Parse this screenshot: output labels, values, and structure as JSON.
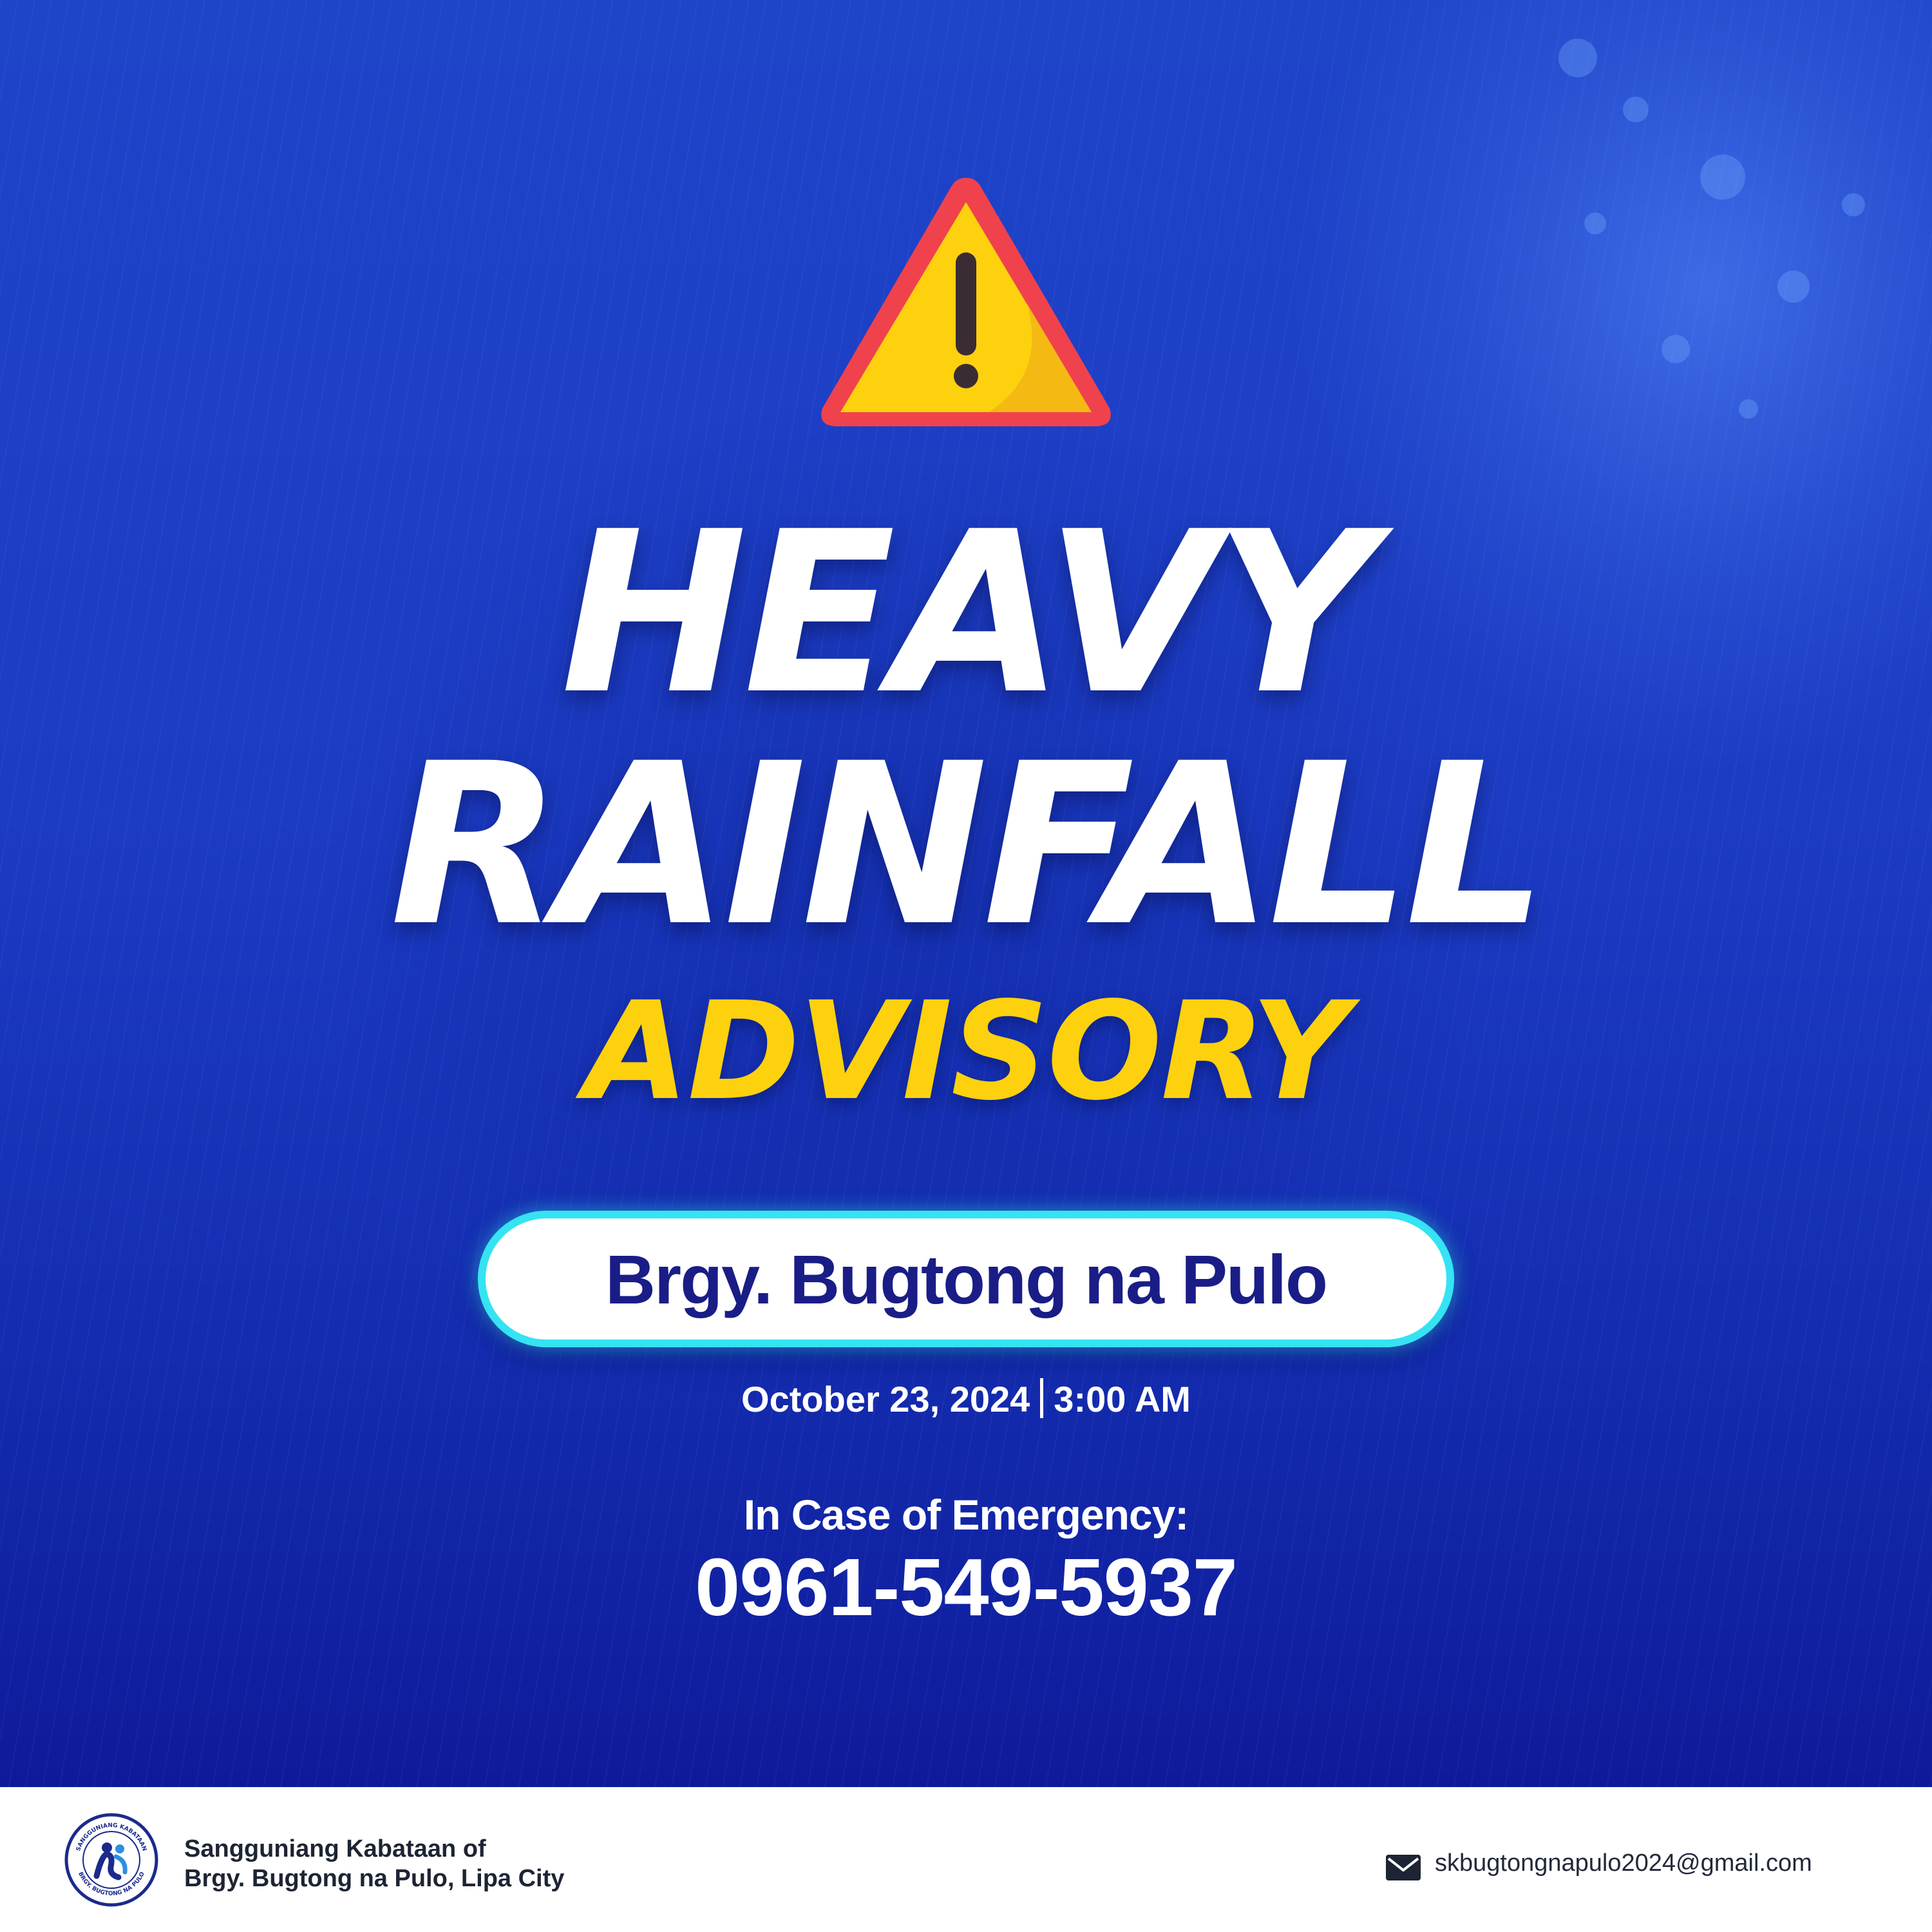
{
  "advisory": {
    "title_line1": "HEAVY",
    "title_line2": "RAINFALL",
    "title_line3": "ADVISORY",
    "location": "Brgy. Bugtong na Pulo",
    "date": "October 23, 2024",
    "time": "3:00 AM"
  },
  "emergency": {
    "label": "In Case of Emergency:",
    "number": "0961-549-5937"
  },
  "footer": {
    "org_line1": "Sangguniang Kabataan of",
    "org_line2": "Brgy. Bugtong na Pulo, Lipa City",
    "email": "skbugtongnapulo2024@gmail.com",
    "logo_text_top": "SANGGUNIANG KABATAAN",
    "logo_text_bottom": "BRGY. BUGTONG NA PULO"
  },
  "icons": {
    "warning": "warning-triangle-icon",
    "email": "envelope-icon"
  },
  "colors": {
    "background": "#1c3cc4",
    "accent_yellow": "#fdd10e",
    "pill_border": "#35e3f2",
    "location_text": "#1a1d86",
    "warning_red": "#f0424c"
  }
}
